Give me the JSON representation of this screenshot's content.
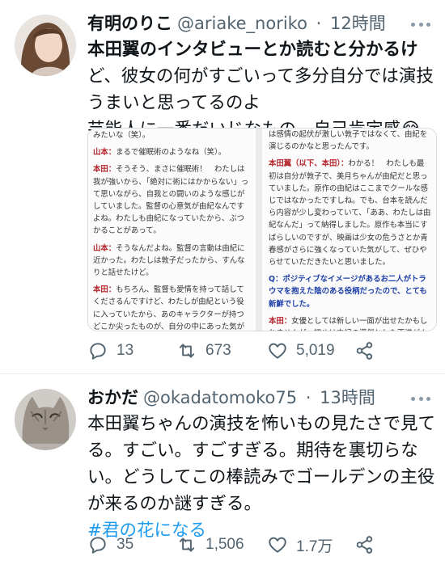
{
  "tweets": [
    {
      "display_name": "有明のりこ",
      "handle": "@ariake_noriko",
      "separator": "·",
      "time": "12時間",
      "text_lines": [
        "本田翼のインタビューとか読むと分かるけ",
        "ど、彼女の何がすごいって多分自分では演技",
        "うまいと思ってるのよ",
        "芸能人に一番だいじなもの、自己肯定感😂"
      ],
      "media": {
        "left_panel": [
          {
            "type": "text",
            "text": "みたいな（笑）。"
          },
          {
            "type": "speaker",
            "speaker": "山本：",
            "text": "まるで催眠術のようなね（笑）。"
          },
          {
            "type": "speaker",
            "speaker": "本田：",
            "text": "そうそう、まさに催眠術！　わたしは我が強いから、「絶対に術にはかからない」って思いながら、自我との闘いのような感じがしていました。監督の心意気が由紀なんですよね。わたしも由紀になっていたから、ぶつかることがあって。"
          },
          {
            "type": "speaker",
            "speaker": "山本：",
            "text": "そうなんだよね。監督の言動は由紀に近かった。わたしは敦子だったから、すんなりと話せたけど。"
          },
          {
            "type": "speaker",
            "speaker": "本田：",
            "text": "もちろん、監督も愛情を持って話してくださるんですけど、わたしが由紀という役に入っていたから、あのキャラクターが持つどこか尖ったものが、自分の中にあった気がします。その幻影で幅のない彩"
          }
        ],
        "right_panel": [
          {
            "type": "text",
            "text": "は感情の起伏が激しい敦子ではなくて、由紀を演じるのかなと思ったんです。"
          },
          {
            "type": "speaker",
            "speaker": "本田翼（以下、本田）：",
            "text": "わかる！　わたしも最初は自分が敦子で、美月ちゃんが由紀だと思っていました。原作の由紀はここまでクールな感じではなかったですしね。でも、台本を読んだら内容が少し変わっていて、「ああ、わたしは由紀なんだ」って納得しました。原作も本当にすばらしいのですが、映画は少女の危うさとか青春感がさらに強くなっていた気がして、ぜひやらせていただきたいと思いました。"
          },
          {
            "type": "question",
            "text": "Q：ポジティブなイメージがあるお二人がトラウマを抱えた陰のある役柄だったので、とても新鮮でした。"
          },
          {
            "type": "speaker",
            "speaker": "本田：",
            "text": "女優としては新しい一面が出せたかもしれませんが、初めは由紀の漠然とした不満がよくわからなくて、わざとイライラすることを見つけたりしていたの"
          }
        ]
      },
      "actions": {
        "reply": "13",
        "retweet": "673",
        "like": "5,019"
      }
    },
    {
      "display_name": "おかだ",
      "handle": "@okadatomoko75",
      "separator": "·",
      "time": "13時間",
      "text_lines": [
        "本田翼ちゃんの演技を怖いもの見たさで見て",
        "る。すごい。すごすぎる。期待を裏切らな",
        "い。どうしてこの棒読みでゴールデンの主役",
        "が来るのか謎すぎる。"
      ],
      "hashtag": "#君の花になる",
      "actions": {
        "reply": "35",
        "retweet": "1,506",
        "like": "1.7万"
      }
    }
  ],
  "icons": {
    "reply": "comment-bubble-icon",
    "retweet": "retweet-arrows-icon",
    "like": "heart-icon",
    "share": "share-icon",
    "more": "more-dots-icon"
  },
  "colors": {
    "text": "#0f1419",
    "secondary": "#536471",
    "link": "#1d9bf0",
    "divider": "#e7e9eb",
    "speaker": "#b5232a",
    "question": "#1d3fa8"
  }
}
